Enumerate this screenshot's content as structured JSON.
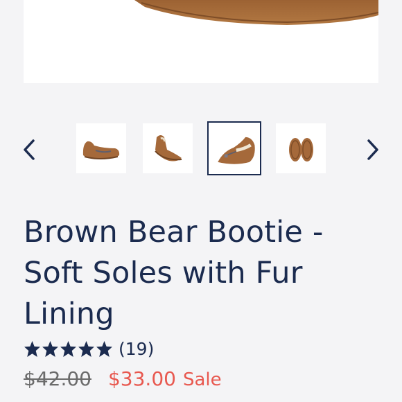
{
  "product": {
    "title": "Brown Bear Bootie - Soft Soles with Fur Lining",
    "rating": {
      "stars": 5,
      "review_count": "(19)"
    },
    "price": {
      "original": "$42.00",
      "sale": "$33.00",
      "sale_label": "Sale"
    }
  },
  "gallery": {
    "thumbnails": [
      {
        "name": "side-view",
        "selected": false
      },
      {
        "name": "front-view",
        "selected": false
      },
      {
        "name": "zipper-view",
        "selected": true
      },
      {
        "name": "sole-view",
        "selected": false
      }
    ],
    "prev_icon": "chevron-left-icon",
    "next_icon": "chevron-right-icon"
  },
  "colors": {
    "navy": "#1b2b4f",
    "sale_red": "#e8584f",
    "leather": "#a5693a"
  }
}
